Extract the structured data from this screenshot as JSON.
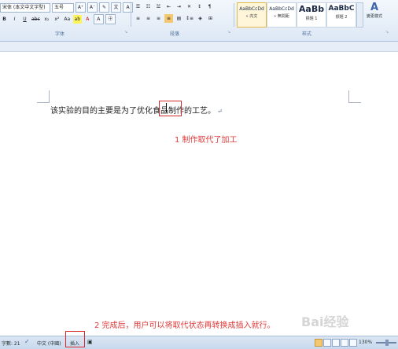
{
  "ribbon": {
    "font_name": "宋体 (本文中文字型)",
    "font_size": "五号",
    "groups": [
      "字体",
      "段落",
      "样式"
    ],
    "styles": [
      {
        "sample": "AaBbCcDd",
        "name": "» 内文"
      },
      {
        "sample": "AaBbCcDd",
        "name": "» 無間距"
      },
      {
        "sample": "AaBb",
        "name": "標題 1"
      },
      {
        "sample": "AaBbC",
        "name": "標題 2"
      }
    ],
    "change_styles_label": "變更樣式"
  },
  "document": {
    "text_before": "该实验的目的主要是为了优化食品",
    "text_highlight": "制作",
    "text_after": "的工艺。",
    "para_mark": "↵"
  },
  "annotations": {
    "note1": "1 制作取代了加工",
    "note2": "2 完成后，用户可以将取代状态再转换成插入就行。"
  },
  "status": {
    "word_count": "字數: 21",
    "language": "中文 (中國)",
    "mode": "插入",
    "zoom": "130%"
  },
  "watermark": "Bai经验"
}
